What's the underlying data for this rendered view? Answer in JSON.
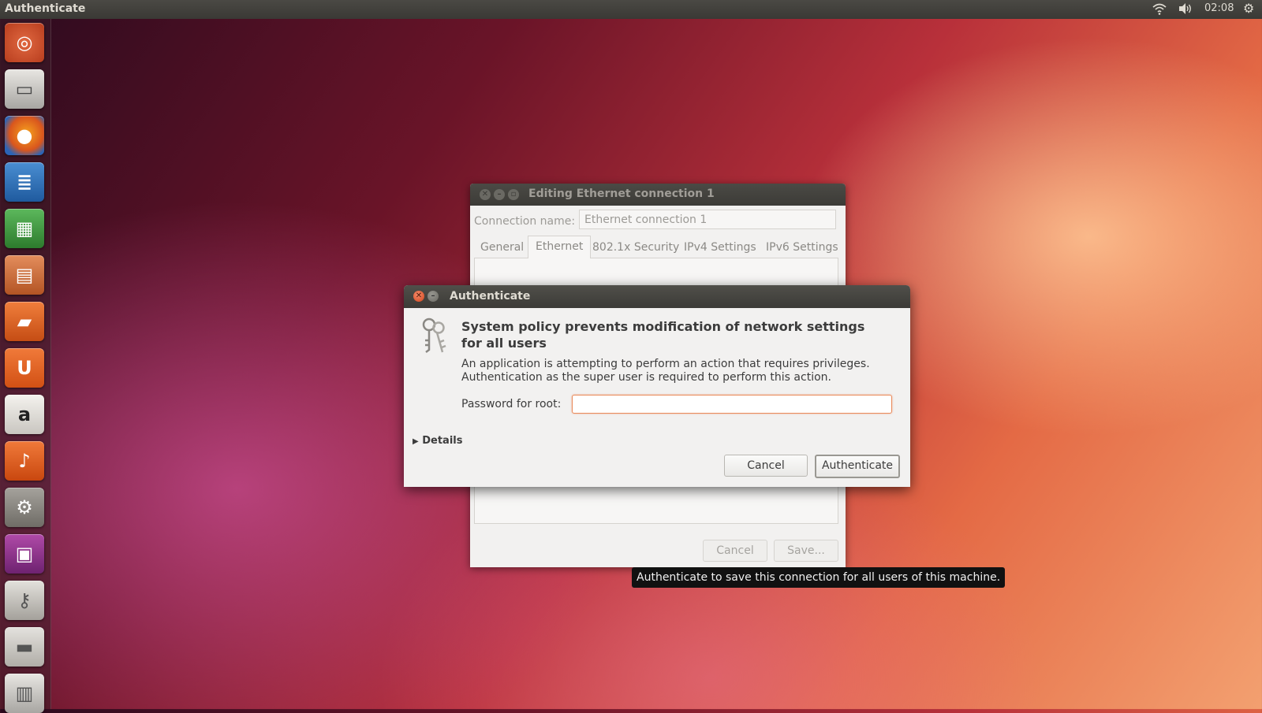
{
  "top_panel": {
    "app_title": "Authenticate",
    "clock": "02:08",
    "icons": [
      "wifi-icon",
      "volume-icon",
      "gear-icon"
    ]
  },
  "launcher": {
    "items": [
      {
        "name": "dash-home",
        "glyph": "◎"
      },
      {
        "name": "files",
        "glyph": "▭"
      },
      {
        "name": "firefox",
        "glyph": "●"
      },
      {
        "name": "writer",
        "glyph": "≣"
      },
      {
        "name": "calc",
        "glyph": "▦"
      },
      {
        "name": "impress",
        "glyph": "▤"
      },
      {
        "name": "software-center",
        "glyph": "▰"
      },
      {
        "name": "ubuntu-one",
        "glyph": "U"
      },
      {
        "name": "amazon",
        "glyph": "a"
      },
      {
        "name": "ubuntu-one-music",
        "glyph": "♪"
      },
      {
        "name": "system-settings",
        "glyph": "⚙"
      },
      {
        "name": "workspaces",
        "glyph": "▣"
      },
      {
        "name": "authenticate",
        "glyph": "⚷"
      },
      {
        "name": "drive",
        "glyph": "▬"
      },
      {
        "name": "trash",
        "glyph": "▥"
      }
    ]
  },
  "bg_window": {
    "title": "Editing Ethernet connection 1",
    "connection_label": "Connection name:",
    "connection_value": "Ethernet connection 1",
    "tabs": [
      "General",
      "Ethernet",
      "802.1x Security",
      "IPv4 Settings",
      "IPv6 Settings"
    ],
    "active_tab": "Ethernet",
    "cancel_label": "Cancel",
    "save_label": "Save..."
  },
  "tooltip": "Authenticate to save this connection for all users of this machine.",
  "auth_dialog": {
    "title": "Authenticate",
    "heading": "System policy prevents modification of network settings for all users",
    "description_line1": "An application is attempting to perform an action that requires privileges.",
    "description_line2": "Authentication as the super user is required to perform this action.",
    "password_label": "Password for root:",
    "password_value": "",
    "details_label": "Details",
    "cancel_label": "Cancel",
    "authenticate_label": "Authenticate"
  },
  "colors": {
    "panel": "#3c3b37",
    "close_button": "#d2461d",
    "focus_border": "#e98a5a",
    "dialog_bg": "#f2f1f0"
  }
}
